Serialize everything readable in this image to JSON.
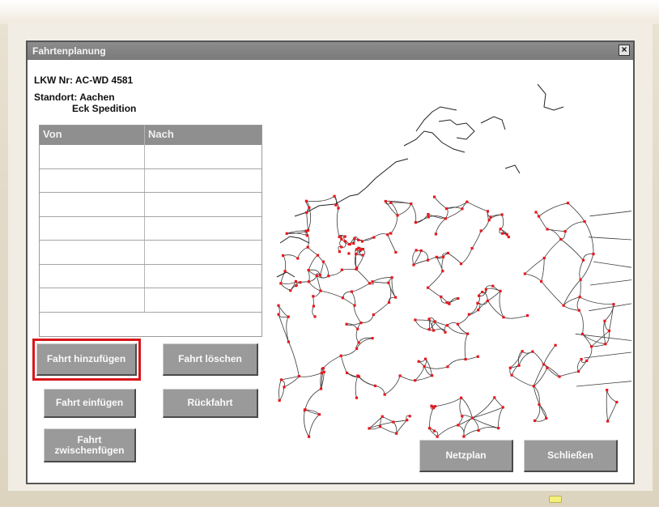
{
  "dialog": {
    "title": "Fahrtenplanung",
    "close_label": "×"
  },
  "truck": {
    "label": "LKW Nr: AC-WD 4581",
    "location_label": "Standort: Aachen",
    "company": "Eck Spedition"
  },
  "table": {
    "headers": [
      "Von",
      "Nach"
    ],
    "rows": 7
  },
  "buttons": {
    "add_trip": "Fahrt hinzufügen",
    "delete_trip": "Fahrt löschen",
    "insert_trip": "Fahrt einfügen",
    "return_trip": "Rückfahrt",
    "insert_between_line1": "Fahrt",
    "insert_between_line2": "zwischenfügen",
    "network_plan": "Netzplan",
    "close": "Schließen"
  },
  "colors": {
    "highlight": "#d8161b",
    "map_node": "#e8171d",
    "map_line": "#3a3a3a"
  }
}
